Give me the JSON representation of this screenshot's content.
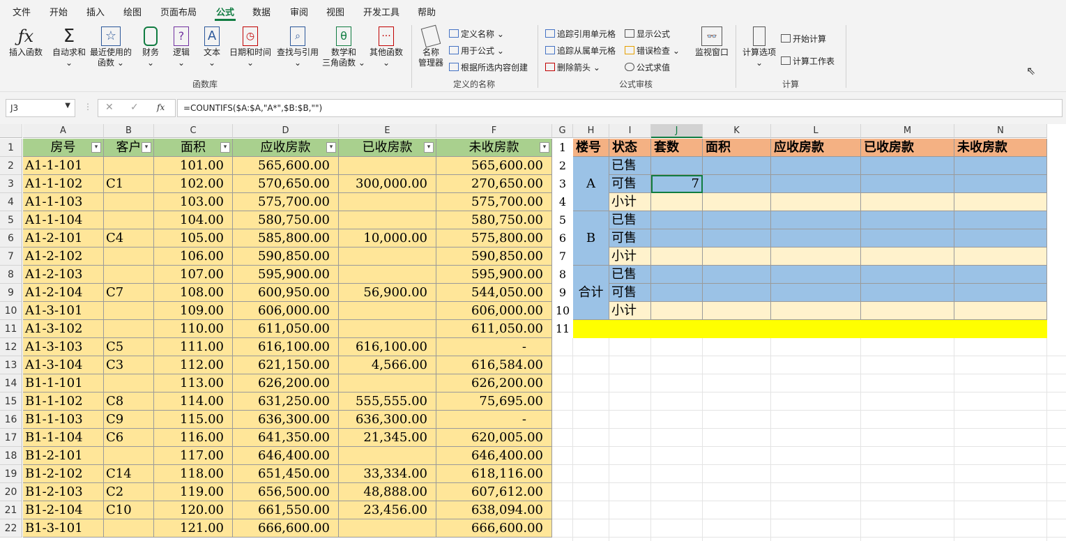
{
  "menu": [
    "文件",
    "开始",
    "插入",
    "绘图",
    "页面布局",
    "公式",
    "数据",
    "审阅",
    "视图",
    "开发工具",
    "帮助"
  ],
  "ribbon": {
    "insert_function": "插入函数",
    "autosum": "自动求和",
    "recent": [
      "最近使用的",
      "函数"
    ],
    "finance": "财务",
    "logic": "逻辑",
    "text": "文本",
    "datetime": "日期和时间",
    "lookup": "查找与引用",
    "math": [
      "数学和",
      "三角函数"
    ],
    "other": "其他函数",
    "group_library": "函数库",
    "name_manager": [
      "名称",
      "管理器"
    ],
    "define_name": "定义名称",
    "use_in_formula": "用于公式",
    "create_from_sel": "根据所选内容创建",
    "group_names": "定义的名称",
    "trace_precedents": "追踪引用单元格",
    "trace_dependents": "追踪从属单元格",
    "remove_arrows": "删除箭头",
    "show_formulas": "显示公式",
    "error_checking": "错误检查",
    "evaluate": "公式求值",
    "watch_window": "监视窗口",
    "group_audit": "公式审核",
    "calc_options": "计算选项",
    "calc_now": "开始计算",
    "calc_sheet": "计算工作表",
    "group_calc": "计算"
  },
  "formula_bar": {
    "name_box": "J3",
    "formula": "=COUNTIFS($A:$A,\"A*\",$B:$B,\"\")"
  },
  "columns": [
    "A",
    "B",
    "C",
    "D",
    "E",
    "F",
    "G",
    "H",
    "I",
    "J",
    "K",
    "L",
    "M",
    "N"
  ],
  "left_headers": [
    "房号",
    "客户",
    "面积",
    "应收房款",
    "已收房款",
    "未收房款"
  ],
  "left_rows": [
    [
      "A1-1-101",
      "",
      "101.00",
      "565,600.00",
      "",
      "565,600.00"
    ],
    [
      "A1-1-102",
      "C1",
      "102.00",
      "570,650.00",
      "300,000.00",
      "270,650.00"
    ],
    [
      "A1-1-103",
      "",
      "103.00",
      "575,700.00",
      "",
      "575,700.00"
    ],
    [
      "A1-1-104",
      "",
      "104.00",
      "580,750.00",
      "",
      "580,750.00"
    ],
    [
      "A1-2-101",
      "C4",
      "105.00",
      "585,800.00",
      "10,000.00",
      "575,800.00"
    ],
    [
      "A1-2-102",
      "",
      "106.00",
      "590,850.00",
      "",
      "590,850.00"
    ],
    [
      "A1-2-103",
      "",
      "107.00",
      "595,900.00",
      "",
      "595,900.00"
    ],
    [
      "A1-2-104",
      "C7",
      "108.00",
      "600,950.00",
      "56,900.00",
      "544,050.00"
    ],
    [
      "A1-3-101",
      "",
      "109.00",
      "606,000.00",
      "",
      "606,000.00"
    ],
    [
      "A1-3-102",
      "",
      "110.00",
      "611,050.00",
      "",
      "611,050.00"
    ],
    [
      "A1-3-103",
      "C5",
      "111.00",
      "616,100.00",
      "616,100.00",
      "-"
    ],
    [
      "A1-3-104",
      "C3",
      "112.00",
      "621,150.00",
      "4,566.00",
      "616,584.00"
    ],
    [
      "B1-1-101",
      "",
      "113.00",
      "626,200.00",
      "",
      "626,200.00"
    ],
    [
      "B1-1-102",
      "C8",
      "114.00",
      "631,250.00",
      "555,555.00",
      "75,695.00"
    ],
    [
      "B1-1-103",
      "C9",
      "115.00",
      "636,300.00",
      "636,300.00",
      "-"
    ],
    [
      "B1-1-104",
      "C6",
      "116.00",
      "641,350.00",
      "21,345.00",
      "620,005.00"
    ],
    [
      "B1-2-101",
      "",
      "117.00",
      "646,400.00",
      "",
      "646,400.00"
    ],
    [
      "B1-2-102",
      "C14",
      "118.00",
      "651,450.00",
      "33,334.00",
      "618,116.00"
    ],
    [
      "B1-2-103",
      "C2",
      "119.00",
      "656,500.00",
      "48,888.00",
      "607,612.00"
    ],
    [
      "B1-2-104",
      "C10",
      "120.00",
      "661,550.00",
      "23,456.00",
      "638,094.00"
    ],
    [
      "B1-3-101",
      "",
      "121.00",
      "666,600.00",
      "",
      "666,600.00"
    ]
  ],
  "right_headers": [
    "楼号",
    "状态",
    "套数",
    "面积",
    "应收房款",
    "已收房款",
    "未收房款"
  ],
  "right_row_numbers": [
    "1",
    "2",
    "3",
    "4",
    "5",
    "6",
    "7",
    "8",
    "9",
    "10",
    "11"
  ],
  "right_groups": [
    "A",
    "B",
    "合计"
  ],
  "right_status": [
    "已售",
    "可售",
    "小计",
    "已售",
    "可售",
    "小计",
    "已售",
    "可售",
    "小计"
  ],
  "right_j3": "7"
}
